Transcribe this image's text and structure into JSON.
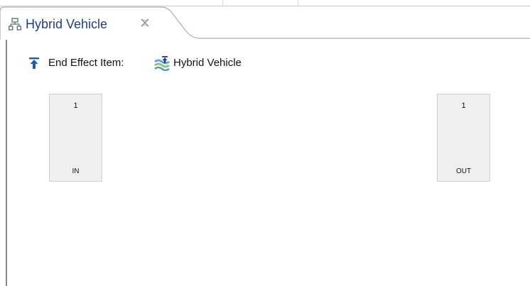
{
  "tab": {
    "title": "Hybrid Vehicle",
    "icon": "diagram-icon",
    "close_icon": "close-icon"
  },
  "editor": {
    "end_effect_label": "End Effect Item:",
    "end_effect_icon": "end-effect-icon",
    "item_icon": "vehicle-item-icon",
    "item_name": "Hybrid Vehicle",
    "blocks": [
      {
        "number": "1",
        "label": "IN"
      },
      {
        "number": "1",
        "label": "OUT"
      }
    ]
  },
  "colors": {
    "tab_title": "#1f3f7a",
    "end_effect_arrow": "#1f5fa8",
    "block_fill": "#efefef",
    "block_border": "#cfcfcf"
  }
}
